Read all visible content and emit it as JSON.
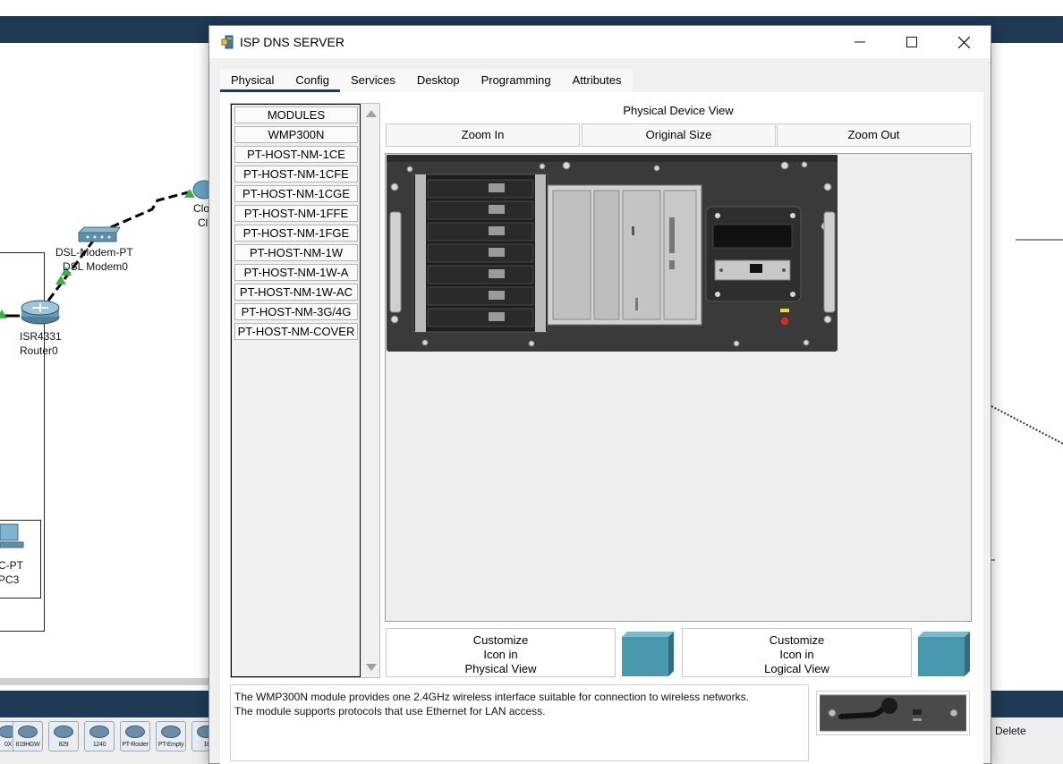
{
  "dialog": {
    "title": "ISP DNS SERVER",
    "window_controls": {
      "minimize": "—",
      "maximize": "☐",
      "close": "✕"
    },
    "tabs": [
      {
        "label": "Physical",
        "active": true
      },
      {
        "label": "Config",
        "active": false
      },
      {
        "label": "Services",
        "active": false
      },
      {
        "label": "Desktop",
        "active": false
      },
      {
        "label": "Programming",
        "active": false
      },
      {
        "label": "Attributes",
        "active": false
      }
    ]
  },
  "modules": {
    "items": [
      "MODULES",
      "WMP300N",
      "PT-HOST-NM-1CE",
      "PT-HOST-NM-1CFE",
      "PT-HOST-NM-1CGE",
      "PT-HOST-NM-1FFE",
      "PT-HOST-NM-1FGE",
      "PT-HOST-NM-1W",
      "PT-HOST-NM-1W-A",
      "PT-HOST-NM-1W-AC",
      "PT-HOST-NM-3G/4G",
      "PT-HOST-NM-COVER"
    ]
  },
  "physical_view": {
    "title": "Physical Device View",
    "zoom_in": "Zoom In",
    "original_size": "Original Size",
    "zoom_out": "Zoom Out"
  },
  "customize": {
    "physical": [
      "Customize",
      "Icon in",
      "Physical View"
    ],
    "logical": [
      "Customize",
      "Icon in",
      "Logical View"
    ]
  },
  "description": {
    "line1": "The WMP300N module provides one 2.4GHz wireless interface suitable for connection to wireless networks.",
    "line2": "The module supports protocols that use Ethernet for LAN access."
  },
  "background": {
    "labels": {
      "dsl_model": "DSL-Modem-PT",
      "dsl_name": "DSL Modem0",
      "router_model": "ISR4331",
      "router_name": "Router0",
      "cloud_model": "Clo",
      "cloud_name": "Cl",
      "pc_model": "C-PT",
      "pc_name": "PC3"
    },
    "device_buttons": [
      "0X",
      "819HGW",
      "829",
      "1240",
      "PT-Router",
      "PT-Empty",
      "18"
    ],
    "delete_label": "Delete"
  },
  "colors": {
    "workspace_bar": "#1f3a55",
    "chassis": "#3a3a3a",
    "icon_teal": "#4a98ad",
    "link_green": "#3cb043"
  }
}
